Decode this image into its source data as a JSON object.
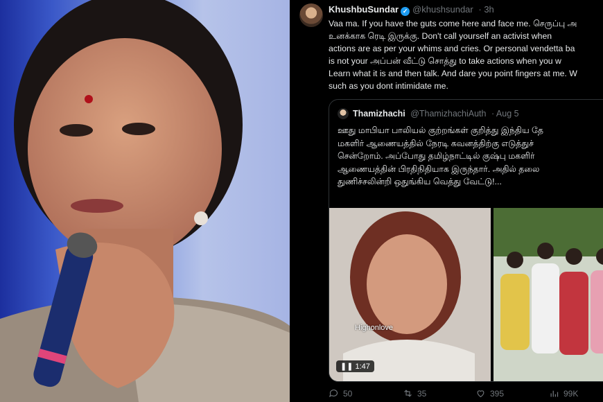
{
  "tweet": {
    "author_name": "KhushbuSundar",
    "author_handle": "@khushsundar",
    "time": "· 3h",
    "text": "Vaa ma. If you have the guts come here and face me. செருப்பு அ\nஉனக்காக ரெடி இருக்கு.  Don't call yourself an activist when\nactions are as per your whims and cries. Or personal vendetta ba\nis not your அப்பன் வீட்டு சொத்து to take actions when you w\nLearn what it is and then talk. And dare you point fingers at me. W\nsuch as you dont intimidate me."
  },
  "quote": {
    "author_name": "Thamizhachi",
    "author_handle": "@ThamizhachiAuth",
    "time": "· Aug 5",
    "text": "ஊது மாபியா பாலியல் குற்றங்கள் குறித்து இந்திய தே\nமகளிர் ஆணையத்தில் நேரடி கவனத்திற்கு எடுத்துச்\nசென்றோம். அப்போது தமிழ்நாட்டில் குஷ்பு மகளிர்\nஆணையத்தின் பிரதிநிதியாக இருந்தார். அதில் தலை\nதுணிச்சலின்றி ஒதுங்கிய வெத்து வேட்டு!...",
    "video_watermark": "Highonlove",
    "video_duration": "1:47"
  },
  "actions": {
    "replies": "50",
    "retweets": "35",
    "likes": "395",
    "views": "99K"
  },
  "colors": {
    "accent": "#1d9bf0",
    "muted": "#71767b",
    "text": "#e7e9ea"
  }
}
